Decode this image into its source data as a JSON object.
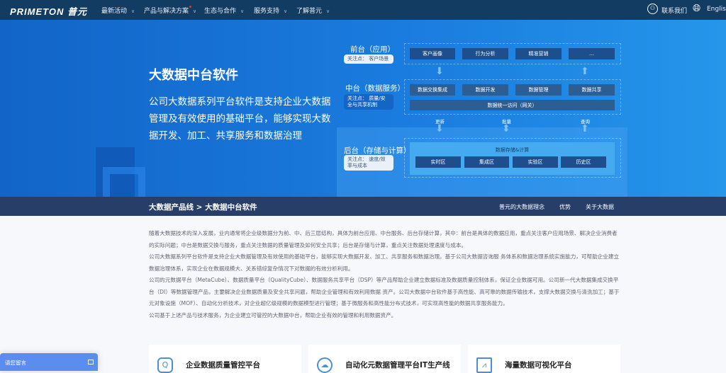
{
  "nav": {
    "logo": "PRIMETON 普元",
    "items": [
      "最新活动",
      "产品与解决方案",
      "生态与合作",
      "服务支持",
      "了解普元"
    ],
    "contact": "联系我们",
    "language": "English"
  },
  "hero": {
    "title": "大数据中台软件",
    "description": "公司大数据系列平台软件是支持企业大数据管理及有效使用的基础平台，能够实现大数据开发、加工、共享服务和数据治理",
    "diagram": {
      "front": {
        "label": "前台（应用）",
        "focus": "关注点：  客户场景",
        "modules": [
          "客户画像",
          "行为分析",
          "精准营销",
          "..."
        ]
      },
      "middle": {
        "label": "中台（数据服务）",
        "focus": "关注点：  质量/安全与共享机制",
        "modules": [
          "数据交换集成",
          "数据开发",
          "数据管理",
          "数据共享"
        ],
        "gateway": "数据统一访问（网关）"
      },
      "flows": [
        "更新",
        "批量",
        "查询"
      ],
      "back": {
        "label": "后台（存储与计算）",
        "focus": "关注点：  速度/效率与成本",
        "title": "数据存储&计算",
        "modules": [
          "实时区",
          "集成区",
          "实验区",
          "历史区"
        ]
      }
    }
  },
  "subnav": {
    "breadcrumb": "大数据产品线 > 大数据中台软件",
    "links": [
      "普元的大数据理念",
      "优势",
      "关于大数据"
    ]
  },
  "content": {
    "paragraphs": [
      "随着大数据技术的深入发展，业内通常将企业级数据分为前、中、后三层结构，具体为前台应用、中台服务、后台存储计算，其中：前台是具体的数据应用，重点关注客户应用场景、解决企业消费者的实际问题；中台是数据交换与服务，重点关注数据的质量管理及如何安全共享；后台是存储与计算，重点关注数据处理速度与成本。",
      "公司大数据系列平台软件是支持企业大数据管理及有效使用的基础平台，能够实现大数据开发、加工、共享服务和数据治理。基于公司大数据咨询服 务体系和数据治理系统实施能力，可帮助企业建立数据治理体系，实现企业在数据规模大、关系错综复杂情况下对数据的有效分析利用。",
      "公司的元数据平台（MetaCube）、数据质量平台（QualityCube）、数据服务共享平台（DSP）等产品帮助企业建立数据标准及数据质量控制体系，保证企业数据可用。公司新一代大数据集成交换平台（DI）等数据管理产品，主要解决企业数据质量及安全共享问题，帮助企业管理和有效利用数据 资产。公司大数据中台软件基于高性能、高可靠的数据传输技术，支撑大数据交换与清洗加工；基于元对象设施（MOF）、自动化分析技术，对企业超亿级规模的数据模型进行管理；基于微服务和高性能分布式技术，可实现高性能的数据共享服务能力。",
      "公司基于上述产品与技术服务，为企业建立可管控的大数据中台，帮助企业有效的管理和利用数据资产。"
    ],
    "cards": [
      "企业数据质量管控平台",
      "自动化元数据管理平台IT生产线",
      "海量数据可视化平台"
    ]
  },
  "chat": {
    "label": "请您留言"
  },
  "colors": {
    "nav": "#133c63",
    "hero": "#1b7ee0",
    "subnav": "#273f68",
    "chat": "#5b8def"
  }
}
